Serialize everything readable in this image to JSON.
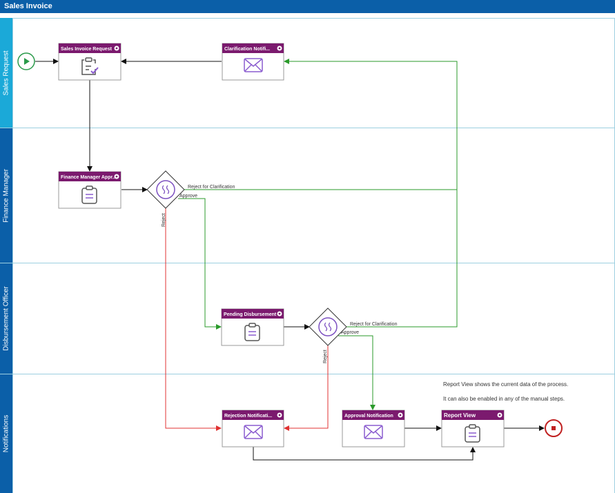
{
  "window": {
    "title": "Sales Invoice"
  },
  "colors": {
    "title_bar": "#0b5fa8",
    "lane_header_light": "#1ba9d8",
    "lane_header_dark": "#0b5fa8",
    "task_header": "#7b1a6e",
    "approve_edge": "#2a9a2a",
    "reject_edge": "#e03030",
    "start_event": "#2a9a4a",
    "end_event": "#c02020"
  },
  "lanes": [
    {
      "id": "sales-request",
      "label": "Sales Request"
    },
    {
      "id": "finance-manager",
      "label": "Finance Manager"
    },
    {
      "id": "disbursement-officer",
      "label": "Disbursement Officer"
    },
    {
      "id": "notifications",
      "label": "Notifications"
    }
  ],
  "tasks": {
    "sales_invoice_request": {
      "title": "Sales Invoice Request",
      "icon": "clipboard-check-icon"
    },
    "clarification_notification": {
      "title": "Clarification Notifi...",
      "icon": "envelope-icon"
    },
    "finance_manager_approval": {
      "title": "Finance Manager Appr...",
      "icon": "clipboard-icon"
    },
    "pending_disbursement": {
      "title": "Pending Disbursement",
      "icon": "clipboard-icon"
    },
    "rejection_notification": {
      "title": "Rejection Notificati...",
      "icon": "envelope-icon"
    },
    "approval_notification": {
      "title": "Approval Notification",
      "icon": "envelope-icon"
    },
    "report_view": {
      "title": "Report View",
      "icon": "clipboard-icon"
    }
  },
  "edge_labels": {
    "fm_reject_for_clarification": "Reject for Clarification",
    "fm_approve": "Approve",
    "fm_reject": "Reject",
    "do_reject_for_clarification": "Reject for Clarification",
    "do_approve": "Approve",
    "do_reject": "Reject"
  },
  "notes": {
    "line1": "Report View shows the current data of the process.",
    "line2": "It can also be enabled in any of the manual steps."
  }
}
